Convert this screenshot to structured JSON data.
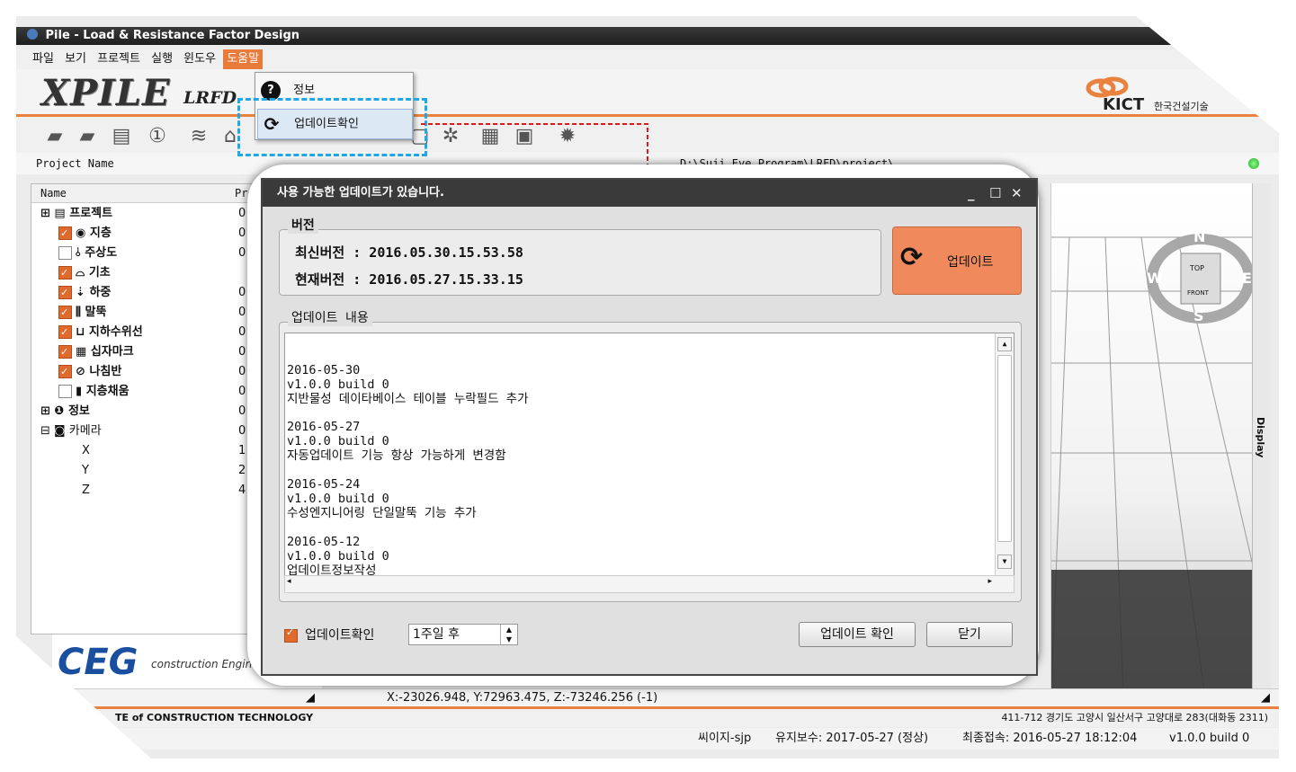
{
  "app": {
    "title": "Pile - Load & Resistance Factor Design",
    "logo_text": "XPILE",
    "logo_sub": "LRFD",
    "kict_logo": "KICT",
    "kict_name": "한국건설기술"
  },
  "menu": [
    "파일",
    "보기",
    "프로젝트",
    "실행",
    "윈도우",
    "도움말"
  ],
  "dropdown": {
    "items": [
      {
        "label": "정보",
        "icon": "help-icon"
      },
      {
        "label": "업데이트확인",
        "icon": "refresh-icon"
      }
    ]
  },
  "project": {
    "label": "Project Name",
    "path": "D:\\Suji_Eye_Program\\LRFD\\project\\"
  },
  "tree": {
    "col_name": "Name",
    "col_prop": "Prope",
    "rows": [
      {
        "label": "프로젝트",
        "value": "0"
      },
      {
        "label": "지층",
        "value": "0"
      },
      {
        "label": "주상도",
        "value": "0"
      },
      {
        "label": "기초",
        "value": ""
      },
      {
        "label": "하중",
        "value": "0"
      },
      {
        "label": "말뚝",
        "value": "0"
      },
      {
        "label": "지하수위선",
        "value": "0"
      },
      {
        "label": "십자마크",
        "value": "0"
      },
      {
        "label": "나침반",
        "value": "0"
      },
      {
        "label": "지층채움",
        "value": "0"
      },
      {
        "label": "정보",
        "value": "0"
      },
      {
        "label": "카메라",
        "value": "0"
      },
      {
        "label": "X",
        "value": "1"
      },
      {
        "label": "Y",
        "value": "2"
      },
      {
        "label": "Z",
        "value": "4"
      }
    ]
  },
  "ceg": {
    "logo": "CEG",
    "sub": "construction Engine"
  },
  "viewport": {
    "compass": {
      "n": "N",
      "s": "S",
      "e": "E",
      "w": "W",
      "top": "TOP",
      "front": "FRONT"
    },
    "display_tab": "Display"
  },
  "dialog": {
    "title": "사용 가능한 업데이트가 있습니다.",
    "version_group": "버전",
    "latest_label": "최신버전 : 2016.05.30.15.53.58",
    "current_label": "현재버전 : 2016.05.27.15.33.15",
    "update_button": "업데이트",
    "content_group": "업데이트 내용",
    "content": "2016-05-30\nv1.0.0 build 0\n지반물성 데이타베이스 테이블 누락필드 추가\n\n2016-05-27\nv1.0.0 build 0\n자동업데이트 기능 항상 가능하게 변경함\n\n2016-05-24\nv1.0.0 build 0\n수성엔지니어링 단일말뚝 기능 추가\n\n2016-05-12\nv1.0.0 build 0\n업데이트정보작성",
    "check_label": "업데이트확인",
    "interval": "1주일 후",
    "check_button": "업데이트 확인",
    "close_button": "닫기"
  },
  "status": {
    "coords": "X:-23026.948, Y:72963.475, Z:-73246.256 (-1)",
    "institute": "TE of CONSTRUCTION TECHNOLOGY",
    "address": "411-712 경기도 고양시 일산서구 고양대로 283(대화동 2311)",
    "user": "씨이지-sjp",
    "maintenance": "유지보수: 2017-05-27 (정상)",
    "last_access": "최종접속: 2016-05-27 18:12:04",
    "version": "v1.0.0 build 0"
  }
}
